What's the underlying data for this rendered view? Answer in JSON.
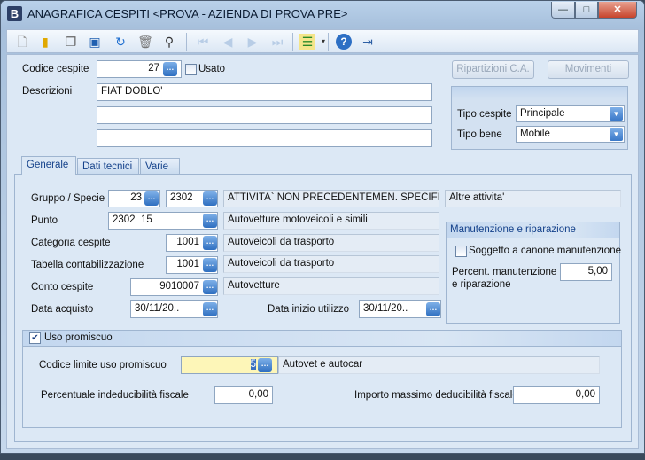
{
  "window": {
    "title": "ANAGRAFICA CESPITI <PROVA - AZIENDA DI PROVA PRE>",
    "logo": "B",
    "controls": [
      "minimize",
      "maximize",
      "close"
    ]
  },
  "toolbar": {
    "icons": [
      "new-icon",
      "open-icon",
      "copy-icon",
      "save-icon",
      "undo-icon",
      "delete-icon",
      "search-icon",
      "first-icon",
      "prev-icon",
      "next-icon",
      "last-icon",
      "list-icon",
      "help-icon",
      "exit-icon"
    ]
  },
  "header": {
    "codice_label": "Codice cespite",
    "codice_value": "27",
    "usato_label": "Usato",
    "descrizioni_label": "Descrizioni",
    "descrizioni": [
      "FIAT DOBLO'",
      "",
      ""
    ],
    "ripartizioni_label": "Ripartizioni C.A.",
    "movimenti_label": "Movimenti",
    "tipo_cespite_label": "Tipo cespite",
    "tipo_cespite_value": "Principale",
    "tipo_bene_label": "Tipo bene",
    "tipo_bene_value": "Mobile"
  },
  "tabs": [
    {
      "label": "Generale"
    },
    {
      "label": "Dati tecnici"
    },
    {
      "label": "Varie"
    }
  ],
  "generale": {
    "gruppo_label": "Gruppo / Specie",
    "gruppo": "23",
    "specie": "2302",
    "gruppo_desc": "ATTIVITA` NON PRECEDENTEMEN. SPECIFICATE",
    "specie_desc": "Altre attivita'",
    "punto_label": "Punto",
    "punto": "2302  15",
    "punto_desc": "Autovetture motoveicoli e simili",
    "categoria_label": "Categoria cespite",
    "categoria": "1001",
    "categoria_desc": "Autoveicoli da trasporto",
    "tabella_label": "Tabella contabilizzazione",
    "tabella": "1001",
    "tabella_desc": "Autoveicoli da trasporto",
    "conto_label": "Conto cespite",
    "conto": "9010007",
    "conto_desc": "Autovetture",
    "data_acquisto_label": "Data acquisto",
    "data_acquisto": "30/11/20..",
    "data_inizio_label": "Data inizio utilizzo",
    "data_inizio": "30/11/20..",
    "manutenzione": {
      "title": "Manutenzione e riparazione",
      "soggetto_label": "Soggetto a canone manutenzione",
      "percent_label_1": "Percent. manutenzione",
      "percent_label_2": "e riparazione",
      "percent_value": "5,00"
    },
    "uso_promiscuo": {
      "title": "Uso promiscuo",
      "checked": true,
      "codice_label": "Codice limite uso promiscuo",
      "codice": "5",
      "codice_desc": "Autovet e autocar",
      "percentuale_label": "Percentuale indeducibilità fiscale",
      "percentuale": "0,00",
      "importo_label": "Importo massimo deducibilità fiscale",
      "importo": "0,00"
    }
  }
}
